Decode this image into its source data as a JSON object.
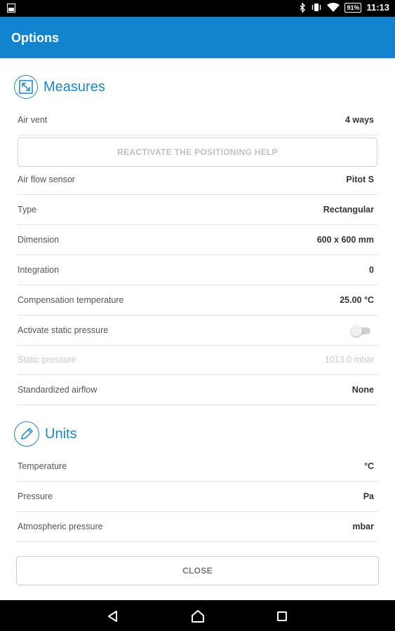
{
  "status_bar": {
    "time": "11:13",
    "battery": "91%"
  },
  "header": {
    "title": "Options"
  },
  "measures": {
    "title": "Measures",
    "air_vent": {
      "label": "Air vent",
      "value": "4 ways"
    },
    "reactivate_label": "REACTIVATE THE POSITIONING HELP",
    "air_flow_sensor": {
      "label": "Air flow sensor",
      "value": "Pitot S"
    },
    "type": {
      "label": "Type",
      "value": "Rectangular"
    },
    "dimension": {
      "label": "Dimension",
      "value": "600 x 600 mm"
    },
    "integration": {
      "label": "Integration",
      "value": "0"
    },
    "compensation_temperature": {
      "label": "Compensation temperature",
      "value": "25.00 °C"
    },
    "activate_static_pressure": {
      "label": "Activate static pressure",
      "enabled": false
    },
    "static_pressure": {
      "label": "Static pressure",
      "value": "1013.0 mbar"
    },
    "standardized_airflow": {
      "label": "Standardized airflow",
      "value": "None"
    }
  },
  "units": {
    "title": "Units",
    "temperature": {
      "label": "Temperature",
      "value": "°C"
    },
    "pressure": {
      "label": "Pressure",
      "value": "Pa"
    },
    "atmospheric_pressure": {
      "label": "Atmospheric pressure",
      "value": "mbar"
    }
  },
  "close_label": "CLOSE",
  "colors": {
    "accent": "#1283cf",
    "disabled_text": "#c9c9c9"
  }
}
